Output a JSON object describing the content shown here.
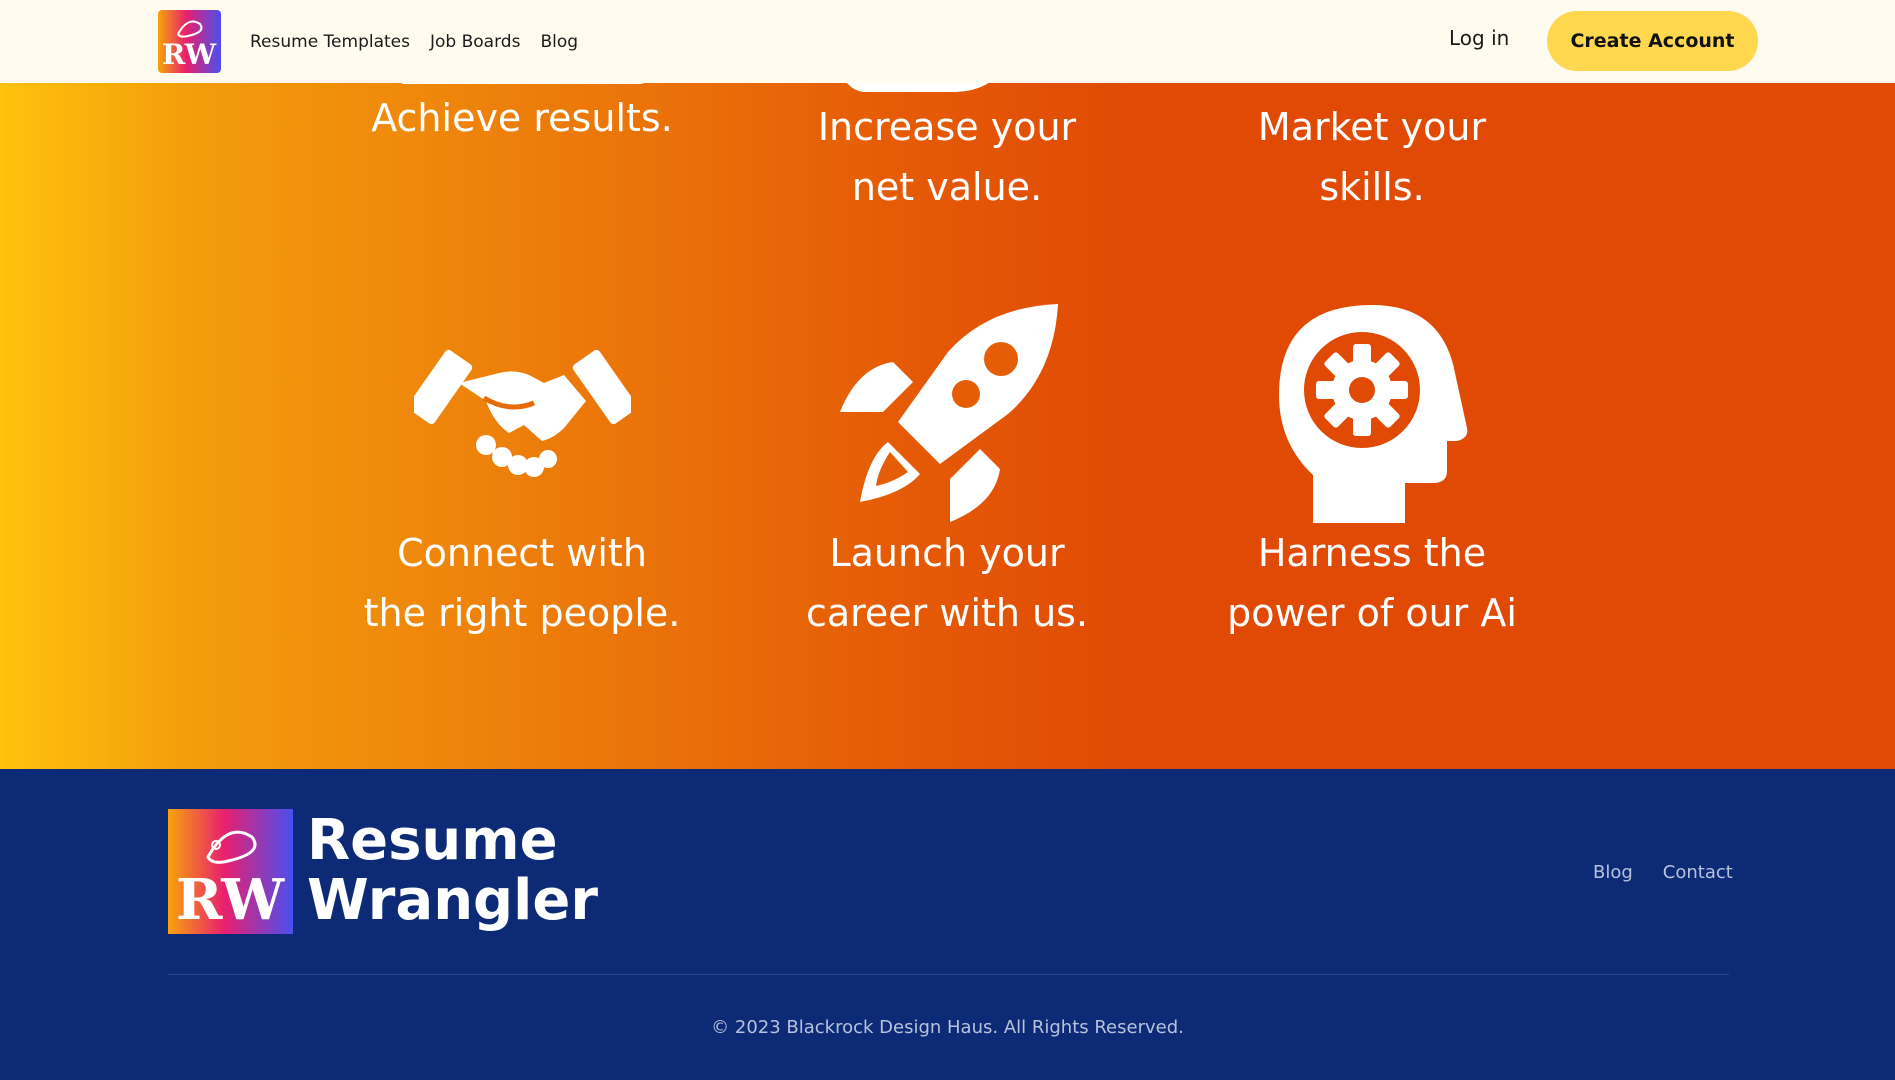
{
  "header": {
    "logo_letters": "RW",
    "nav": [
      {
        "label": "Resume Templates"
      },
      {
        "label": "Job Boards"
      },
      {
        "label": "Blog"
      }
    ],
    "login_label": "Log in",
    "create_account_label": "Create Account"
  },
  "features_top": [
    {
      "line1": "Achieve results.",
      "line2": ""
    },
    {
      "line1": "Increase your",
      "line2": "net value."
    },
    {
      "line1": "Market your",
      "line2": "skills."
    }
  ],
  "features_bottom": [
    {
      "icon": "handshake-icon",
      "line1": "Connect with",
      "line2": "the right people."
    },
    {
      "icon": "rocket-icon",
      "line1": "Launch your",
      "line2": "career with us."
    },
    {
      "icon": "head-gear-icon",
      "line1": "Harness the",
      "line2": "power of our Ai"
    }
  ],
  "footer": {
    "logo_letters": "RW",
    "brand_line1": "Resume",
    "brand_line2": "Wrangler",
    "links": [
      {
        "label": "Blog"
      },
      {
        "label": "Contact"
      }
    ],
    "copyright": "© 2023 Blackrock Design Haus. All Rights Reserved."
  },
  "colors": {
    "header_bg": "#fffbee",
    "accent_button": "#ffd84f",
    "gradient_start": "#ffc20d",
    "gradient_end": "#e04a05",
    "footer_bg": "#0c2a75"
  }
}
